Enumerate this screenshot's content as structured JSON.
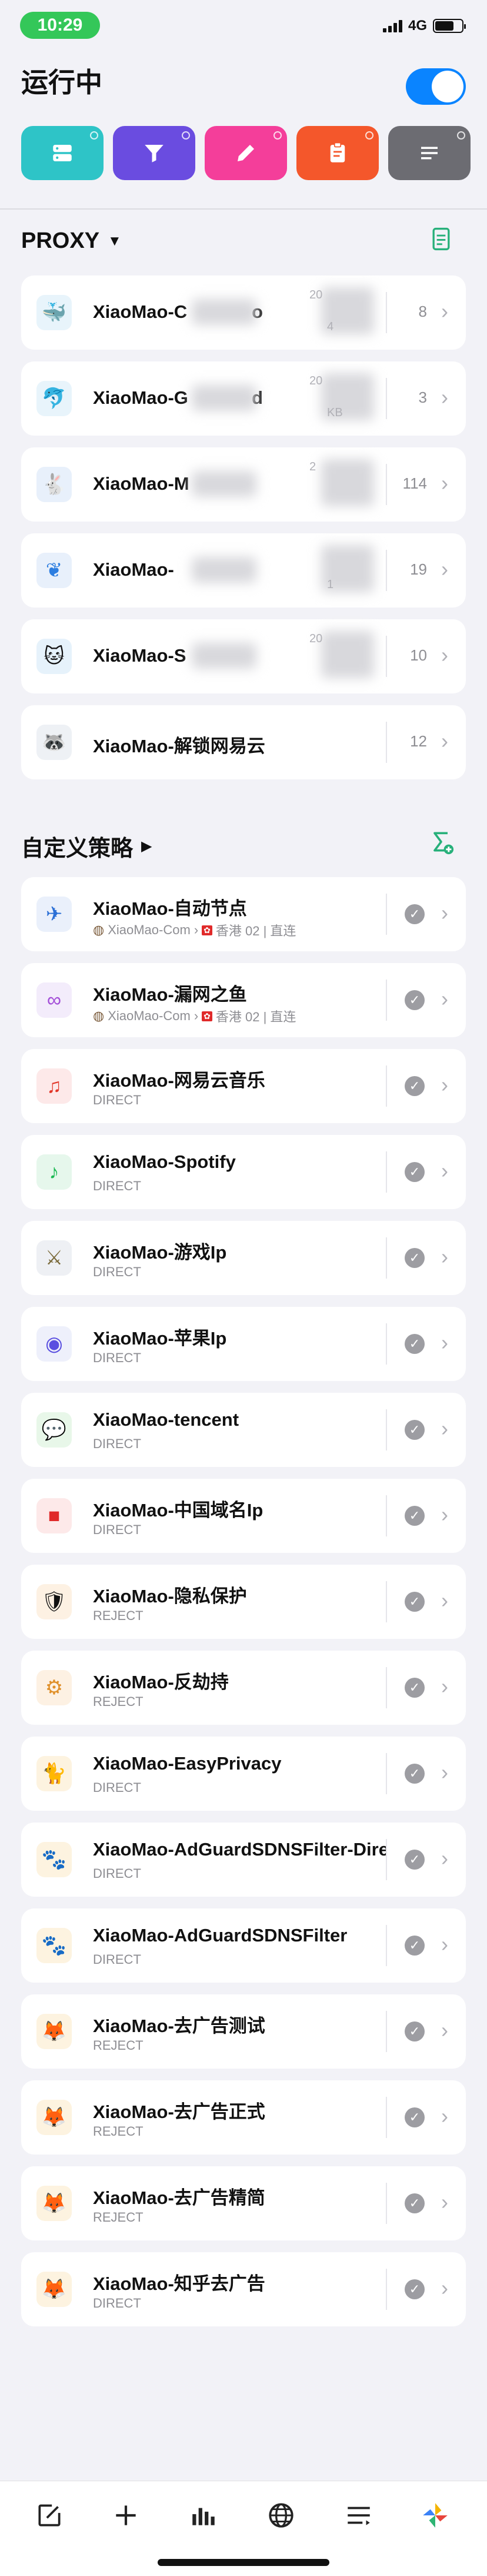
{
  "status": {
    "time": "10:29",
    "network": "4G"
  },
  "header": {
    "title": "运行中",
    "toggle_on": true
  },
  "tiles": [
    {
      "icon": "server-icon",
      "color": "#2ec4c7"
    },
    {
      "icon": "filter-icon",
      "color": "#6a4ce0"
    },
    {
      "icon": "pencil-icon",
      "color": "#f43e9a"
    },
    {
      "icon": "clipboard-icon",
      "color": "#f4572b"
    },
    {
      "icon": "lines-icon",
      "color": "#6c6c72"
    }
  ],
  "proxy_section": {
    "title": "PROXY"
  },
  "proxy_items": [
    {
      "name": "XiaoMao-C",
      "name_tail": "o",
      "count": "8",
      "icon": "whale-icon",
      "date": "20",
      "size": "4"
    },
    {
      "name": "XiaoMao-G",
      "name_tail": "d",
      "count": "3",
      "icon": "dolphin-icon",
      "date": "20",
      "size": "KB"
    },
    {
      "name": "XiaoMao-M",
      "name_tail": "",
      "count": "114",
      "icon": "rabbit-icon",
      "date": "2",
      "size": ""
    },
    {
      "name": "XiaoMao-",
      "name_tail": "",
      "count": "19",
      "icon": "leaf-icon",
      "date": "",
      "size": "1"
    },
    {
      "name": "XiaoMao-S",
      "name_tail": "",
      "count": "10",
      "icon": "cat-icon",
      "date": "20",
      "size": ""
    },
    {
      "name": "XiaoMao-解锁网易云",
      "name_tail": "",
      "count": "12",
      "icon": "raccoon-icon",
      "date": "",
      "size": ""
    }
  ],
  "policy_section": {
    "title": "自定义策略"
  },
  "policy_items": [
    {
      "name": "XiaoMao-自动节点",
      "sub_a": "XiaoMao-Com",
      "sub_b": "香港 02 | 直连",
      "icon": "plane-icon"
    },
    {
      "name": "XiaoMao-漏网之鱼",
      "sub_a": "XiaoMao-Com",
      "sub_b": "香港 02 | 直连",
      "icon": "infinity-icon"
    },
    {
      "name": "XiaoMao-网易云音乐",
      "sub": "DIRECT",
      "icon": "netease-icon"
    },
    {
      "name": "XiaoMao-Spotify",
      "sub": "DIRECT",
      "icon": "spotify-icon"
    },
    {
      "name": "XiaoMao-游戏Ip",
      "sub": "DIRECT",
      "icon": "game-icon"
    },
    {
      "name": "XiaoMao-苹果Ip",
      "sub": "DIRECT",
      "icon": "siri-icon"
    },
    {
      "name": "XiaoMao-tencent",
      "sub": "DIRECT",
      "icon": "wechat-icon"
    },
    {
      "name": "XiaoMao-中国域名Ip",
      "sub": "DIRECT",
      "icon": "china-map-icon"
    },
    {
      "name": "XiaoMao-隐私保护",
      "sub": "REJECT",
      "icon": "privacy-icon"
    },
    {
      "name": "XiaoMao-反劫持",
      "sub": "REJECT",
      "icon": "drill-icon"
    },
    {
      "name": "XiaoMao-EasyPrivacy",
      "sub": "DIRECT",
      "icon": "cat-orange-icon"
    },
    {
      "name": "XiaoMao-AdGuardSDNSFilter-Dire",
      "sub": "DIRECT",
      "icon": "adguard-cat-icon"
    },
    {
      "name": "XiaoMao-AdGuardSDNSFilter",
      "sub": "DIRECT",
      "icon": "adguard-cat-icon"
    },
    {
      "name": "XiaoMao-去广告测试",
      "sub": "REJECT",
      "icon": "fox-icon"
    },
    {
      "name": "XiaoMao-去广告正式",
      "sub": "REJECT",
      "icon": "fox-icon"
    },
    {
      "name": "XiaoMao-去广告精简",
      "sub": "REJECT",
      "icon": "fox-icon"
    },
    {
      "name": "XiaoMao-知乎去广告",
      "sub": "DIRECT",
      "icon": "fox-icon"
    }
  ],
  "tabbar": [
    {
      "icon": "edit-icon"
    },
    {
      "icon": "plus-icon"
    },
    {
      "icon": "bar-chart-icon"
    },
    {
      "icon": "globe-icon"
    },
    {
      "icon": "list-icon"
    },
    {
      "icon": "pinwheel-icon"
    }
  ]
}
